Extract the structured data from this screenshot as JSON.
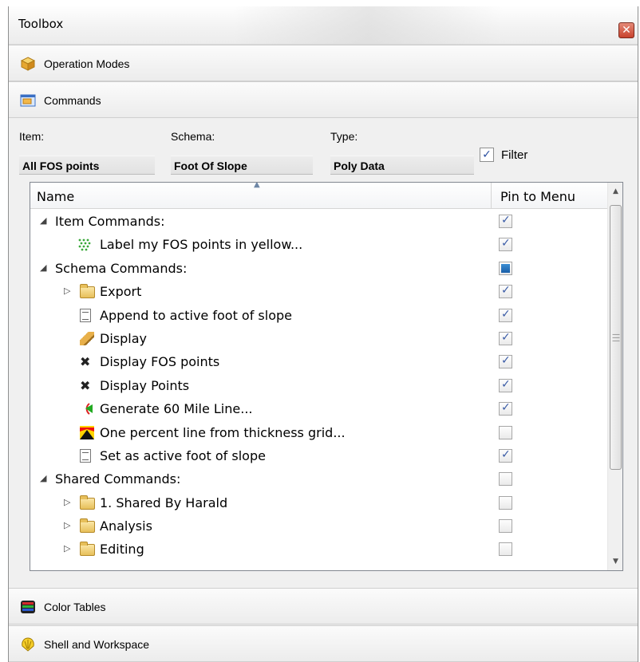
{
  "window": {
    "title": "Toolbox",
    "close_glyph": "✕"
  },
  "sections": {
    "operation_modes": "Operation Modes",
    "commands": "Commands",
    "color_tables": "Color Tables",
    "shell_workspace": "Shell and Workspace"
  },
  "filter": {
    "item_label": "Item:",
    "item_value": "All FOS points",
    "schema_label": "Schema:",
    "schema_value": "Foot Of Slope",
    "type_label": "Type:",
    "type_value": "Poly Data",
    "filter_label": "Filter",
    "filter_checked": true
  },
  "grid": {
    "col_name": "Name",
    "col_pin": "Pin to Menu",
    "rows": [
      {
        "label": "Item Commands:",
        "level": 0,
        "expander": "◢",
        "icon": null,
        "pin": "checked"
      },
      {
        "label": "Label my FOS points in yellow...",
        "level": 2,
        "expander": null,
        "icon": "dotted-green-icon",
        "pin": "checked"
      },
      {
        "label": "Schema Commands:",
        "level": 0,
        "expander": "◢",
        "icon": null,
        "pin": "partial"
      },
      {
        "label": "Export",
        "level": 1,
        "expander": "▷",
        "icon": "folder-icon",
        "pin": "checked"
      },
      {
        "label": "Append to active foot of slope",
        "level": 1,
        "expander": null,
        "icon": "document-icon",
        "pin": "checked"
      },
      {
        "label": "Display",
        "level": 1,
        "expander": null,
        "icon": "pencil-icon",
        "pin": "checked"
      },
      {
        "label": "Display FOS points",
        "level": 1,
        "expander": null,
        "icon": "points-icon",
        "pin": "checked"
      },
      {
        "label": "Display Points",
        "level": 1,
        "expander": null,
        "icon": "points-icon",
        "pin": "checked"
      },
      {
        "label": "Generate 60 Mile Line...",
        "level": 1,
        "expander": null,
        "icon": "arc-line-icon",
        "pin": "checked"
      },
      {
        "label": "One percent line from thickness grid...",
        "level": 1,
        "expander": null,
        "icon": "grid-line-icon",
        "pin": "unchecked"
      },
      {
        "label": "Set as active foot of slope",
        "level": 1,
        "expander": null,
        "icon": "document-icon",
        "pin": "checked"
      },
      {
        "label": "Shared Commands:",
        "level": 0,
        "expander": "◢",
        "icon": null,
        "pin": "unchecked"
      },
      {
        "label": "1. Shared By Harald",
        "level": 1,
        "expander": "▷",
        "icon": "folder-icon",
        "pin": "unchecked"
      },
      {
        "label": "Analysis",
        "level": 1,
        "expander": "▷",
        "icon": "folder-icon",
        "pin": "unchecked"
      },
      {
        "label": "Editing",
        "level": 1,
        "expander": "▷",
        "icon": "folder-icon",
        "pin": "unchecked"
      }
    ]
  }
}
